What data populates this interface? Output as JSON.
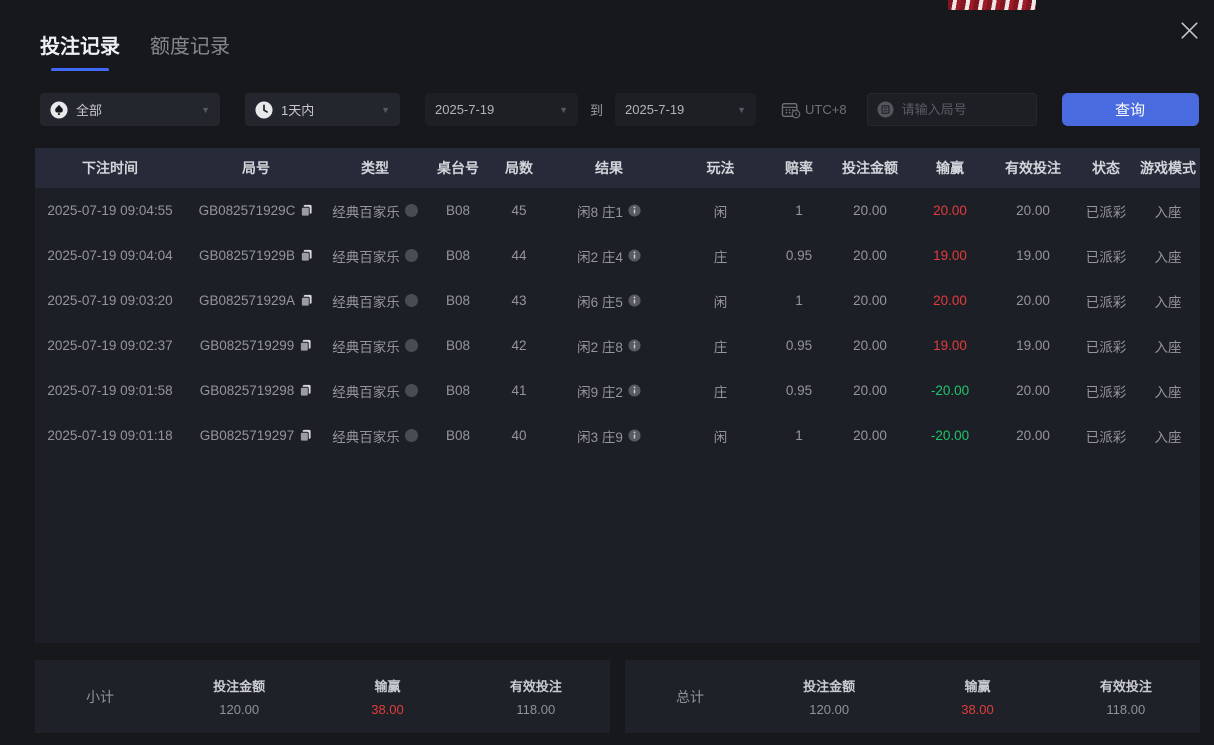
{
  "tabs": {
    "bet_records": "投注记录",
    "quota_records": "额度记录"
  },
  "filters": {
    "game_type": "全部",
    "time_range": "1天内",
    "date_from": "2025-7-19",
    "to_label": "到",
    "date_to": "2025-7-19",
    "timezone": "UTC+8",
    "round_placeholder": "请输入局号",
    "query_button": "查询"
  },
  "table": {
    "columns": [
      "下注时间",
      "局号",
      "类型",
      "桌台号",
      "局数",
      "结果",
      "玩法",
      "赔率",
      "投注金额",
      "输赢",
      "有效投注",
      "状态",
      "游戏模式"
    ],
    "rows": [
      {
        "time": "2025-07-19 09:04:55",
        "round_id": "GB082571929C",
        "game_type": "经典百家乐",
        "table_no": "B08",
        "round_no": "45",
        "result": "闲8 庄1",
        "play": "闲",
        "odds": "1",
        "bet_amount": "20.00",
        "win_loss": "20.00",
        "valid_bet": "20.00",
        "status": "已派彩",
        "mode": "入座"
      },
      {
        "time": "2025-07-19 09:04:04",
        "round_id": "GB082571929B",
        "game_type": "经典百家乐",
        "table_no": "B08",
        "round_no": "44",
        "result": "闲2 庄4",
        "play": "庄",
        "odds": "0.95",
        "bet_amount": "20.00",
        "win_loss": "19.00",
        "valid_bet": "19.00",
        "status": "已派彩",
        "mode": "入座"
      },
      {
        "time": "2025-07-19 09:03:20",
        "round_id": "GB082571929A",
        "game_type": "经典百家乐",
        "table_no": "B08",
        "round_no": "43",
        "result": "闲6 庄5",
        "play": "闲",
        "odds": "1",
        "bet_amount": "20.00",
        "win_loss": "20.00",
        "valid_bet": "20.00",
        "status": "已派彩",
        "mode": "入座"
      },
      {
        "time": "2025-07-19 09:02:37",
        "round_id": "GB0825719299",
        "game_type": "经典百家乐",
        "table_no": "B08",
        "round_no": "42",
        "result": "闲2 庄8",
        "play": "庄",
        "odds": "0.95",
        "bet_amount": "20.00",
        "win_loss": "19.00",
        "valid_bet": "19.00",
        "status": "已派彩",
        "mode": "入座"
      },
      {
        "time": "2025-07-19 09:01:58",
        "round_id": "GB0825719298",
        "game_type": "经典百家乐",
        "table_no": "B08",
        "round_no": "41",
        "result": "闲9 庄2",
        "play": "庄",
        "odds": "0.95",
        "bet_amount": "20.00",
        "win_loss": "-20.00",
        "valid_bet": "20.00",
        "status": "已派彩",
        "mode": "入座"
      },
      {
        "time": "2025-07-19 09:01:18",
        "round_id": "GB0825719297",
        "game_type": "经典百家乐",
        "table_no": "B08",
        "round_no": "40",
        "result": "闲3 庄9",
        "play": "闲",
        "odds": "1",
        "bet_amount": "20.00",
        "win_loss": "-20.00",
        "valid_bet": "20.00",
        "status": "已派彩",
        "mode": "入座"
      }
    ]
  },
  "summary": {
    "subtotal": {
      "label": "小计",
      "bet_amount_label": "投注金额",
      "bet_amount": "120.00",
      "win_loss_label": "输赢",
      "win_loss": "38.00",
      "valid_bet_label": "有效投注",
      "valid_bet": "118.00"
    },
    "total": {
      "label": "总计",
      "bet_amount_label": "投注金额",
      "bet_amount": "120.00",
      "win_loss_label": "输赢",
      "win_loss": "38.00",
      "valid_bet_label": "有效投注",
      "valid_bet": "118.00"
    }
  },
  "colors": {
    "accent_blue": "#4a6bdf",
    "tab_underline": "#3e68f6",
    "win_red": "#e23c3c",
    "loss_green": "#22c36b",
    "page_bg": "#17181c",
    "panel_bg": "#1d1f26",
    "header_bg": "#272b39"
  }
}
